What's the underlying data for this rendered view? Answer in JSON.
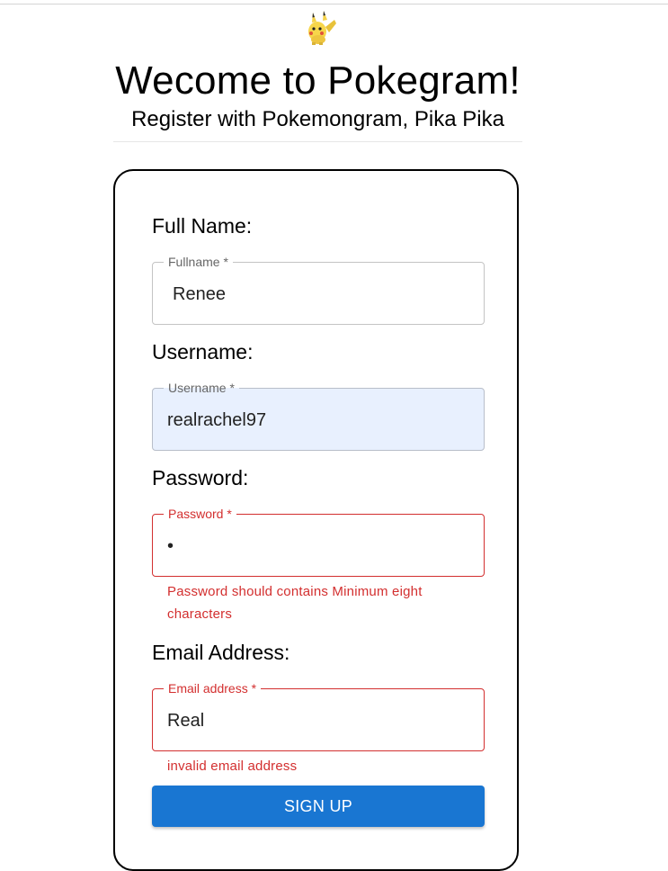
{
  "header": {
    "title": "Wecome to Pokegram!",
    "subtitle": "Register with Pokemongram, Pika Pika",
    "mascot_icon": "pikachu-icon"
  },
  "form": {
    "fullname": {
      "label": "Full Name:",
      "legend": "Fullname *",
      "value": "Renee"
    },
    "username": {
      "label": "Username:",
      "legend": "Username *",
      "value": "realrachel97"
    },
    "password": {
      "label": "Password:",
      "legend": "Password *",
      "value": "•",
      "error": "Password should contains Minimum eight characters"
    },
    "email": {
      "label": "Email Address:",
      "legend": "Email address *",
      "value": "Real",
      "error": "invalid email address"
    },
    "signup_label": "SIGN UP"
  },
  "colors": {
    "primary": "#1976d2",
    "error": "#d32f2f",
    "autofill": "#e8f0fe"
  }
}
